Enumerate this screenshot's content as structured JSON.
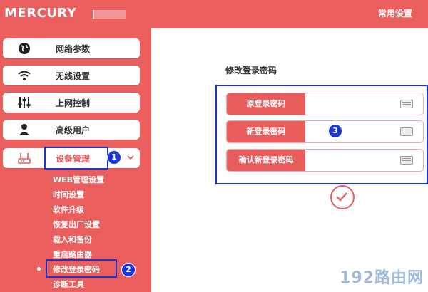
{
  "header": {
    "brand": "MERCURY",
    "top_link": "常用设置"
  },
  "sidebar": {
    "items": [
      {
        "label": "网络参数",
        "icon": "globe-icon"
      },
      {
        "label": "无线设置",
        "icon": "wifi-icon"
      },
      {
        "label": "上网控制",
        "icon": "sliders-icon"
      },
      {
        "label": "高级用户",
        "icon": "user-icon"
      },
      {
        "label": "设备管理",
        "icon": "router-icon"
      }
    ],
    "sub_items": [
      "WEB管理设置",
      "时间设置",
      "软件升级",
      "恢复出厂设置",
      "载入和备份",
      "重启路由器",
      "修改登录密码",
      "诊断工具"
    ]
  },
  "main": {
    "title": "修改登录密码",
    "fields": [
      {
        "label": "原登录密码",
        "value": ""
      },
      {
        "label": "新登录密码",
        "value": ""
      },
      {
        "label": "确认新登录密码",
        "value": ""
      }
    ],
    "confirm_icon": "check-icon"
  },
  "annotations": [
    "1",
    "2",
    "3"
  ],
  "watermark": "192路由网",
  "colors": {
    "accent": "#e85c5c",
    "annotation": "#1a35d6",
    "white": "#ffffff"
  }
}
